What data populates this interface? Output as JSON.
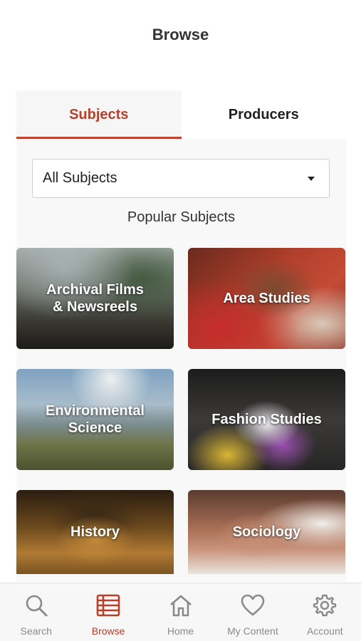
{
  "header": {
    "title": "Browse"
  },
  "tabs": [
    {
      "label": "Subjects",
      "active": true
    },
    {
      "label": "Producers",
      "active": false
    }
  ],
  "filter": {
    "selected": "All Subjects"
  },
  "section": {
    "title": "Popular Subjects"
  },
  "subjects": [
    {
      "label": "Archival Films & Newsreels"
    },
    {
      "label": "Area Studies"
    },
    {
      "label": "Environmental Science"
    },
    {
      "label": "Fashion Studies"
    },
    {
      "label": "History"
    },
    {
      "label": "Sociology"
    }
  ],
  "tabbar": {
    "items": [
      {
        "label": "Search",
        "icon": "search-icon",
        "active": false
      },
      {
        "label": "Browse",
        "icon": "browse-icon",
        "active": true
      },
      {
        "label": "Home",
        "icon": "home-icon",
        "active": false
      },
      {
        "label": "My Content",
        "icon": "heart-icon",
        "active": false
      },
      {
        "label": "Account",
        "icon": "gear-icon",
        "active": false
      }
    ]
  },
  "colors": {
    "accent": "#b8402a",
    "inactive": "#8a8a8a"
  }
}
